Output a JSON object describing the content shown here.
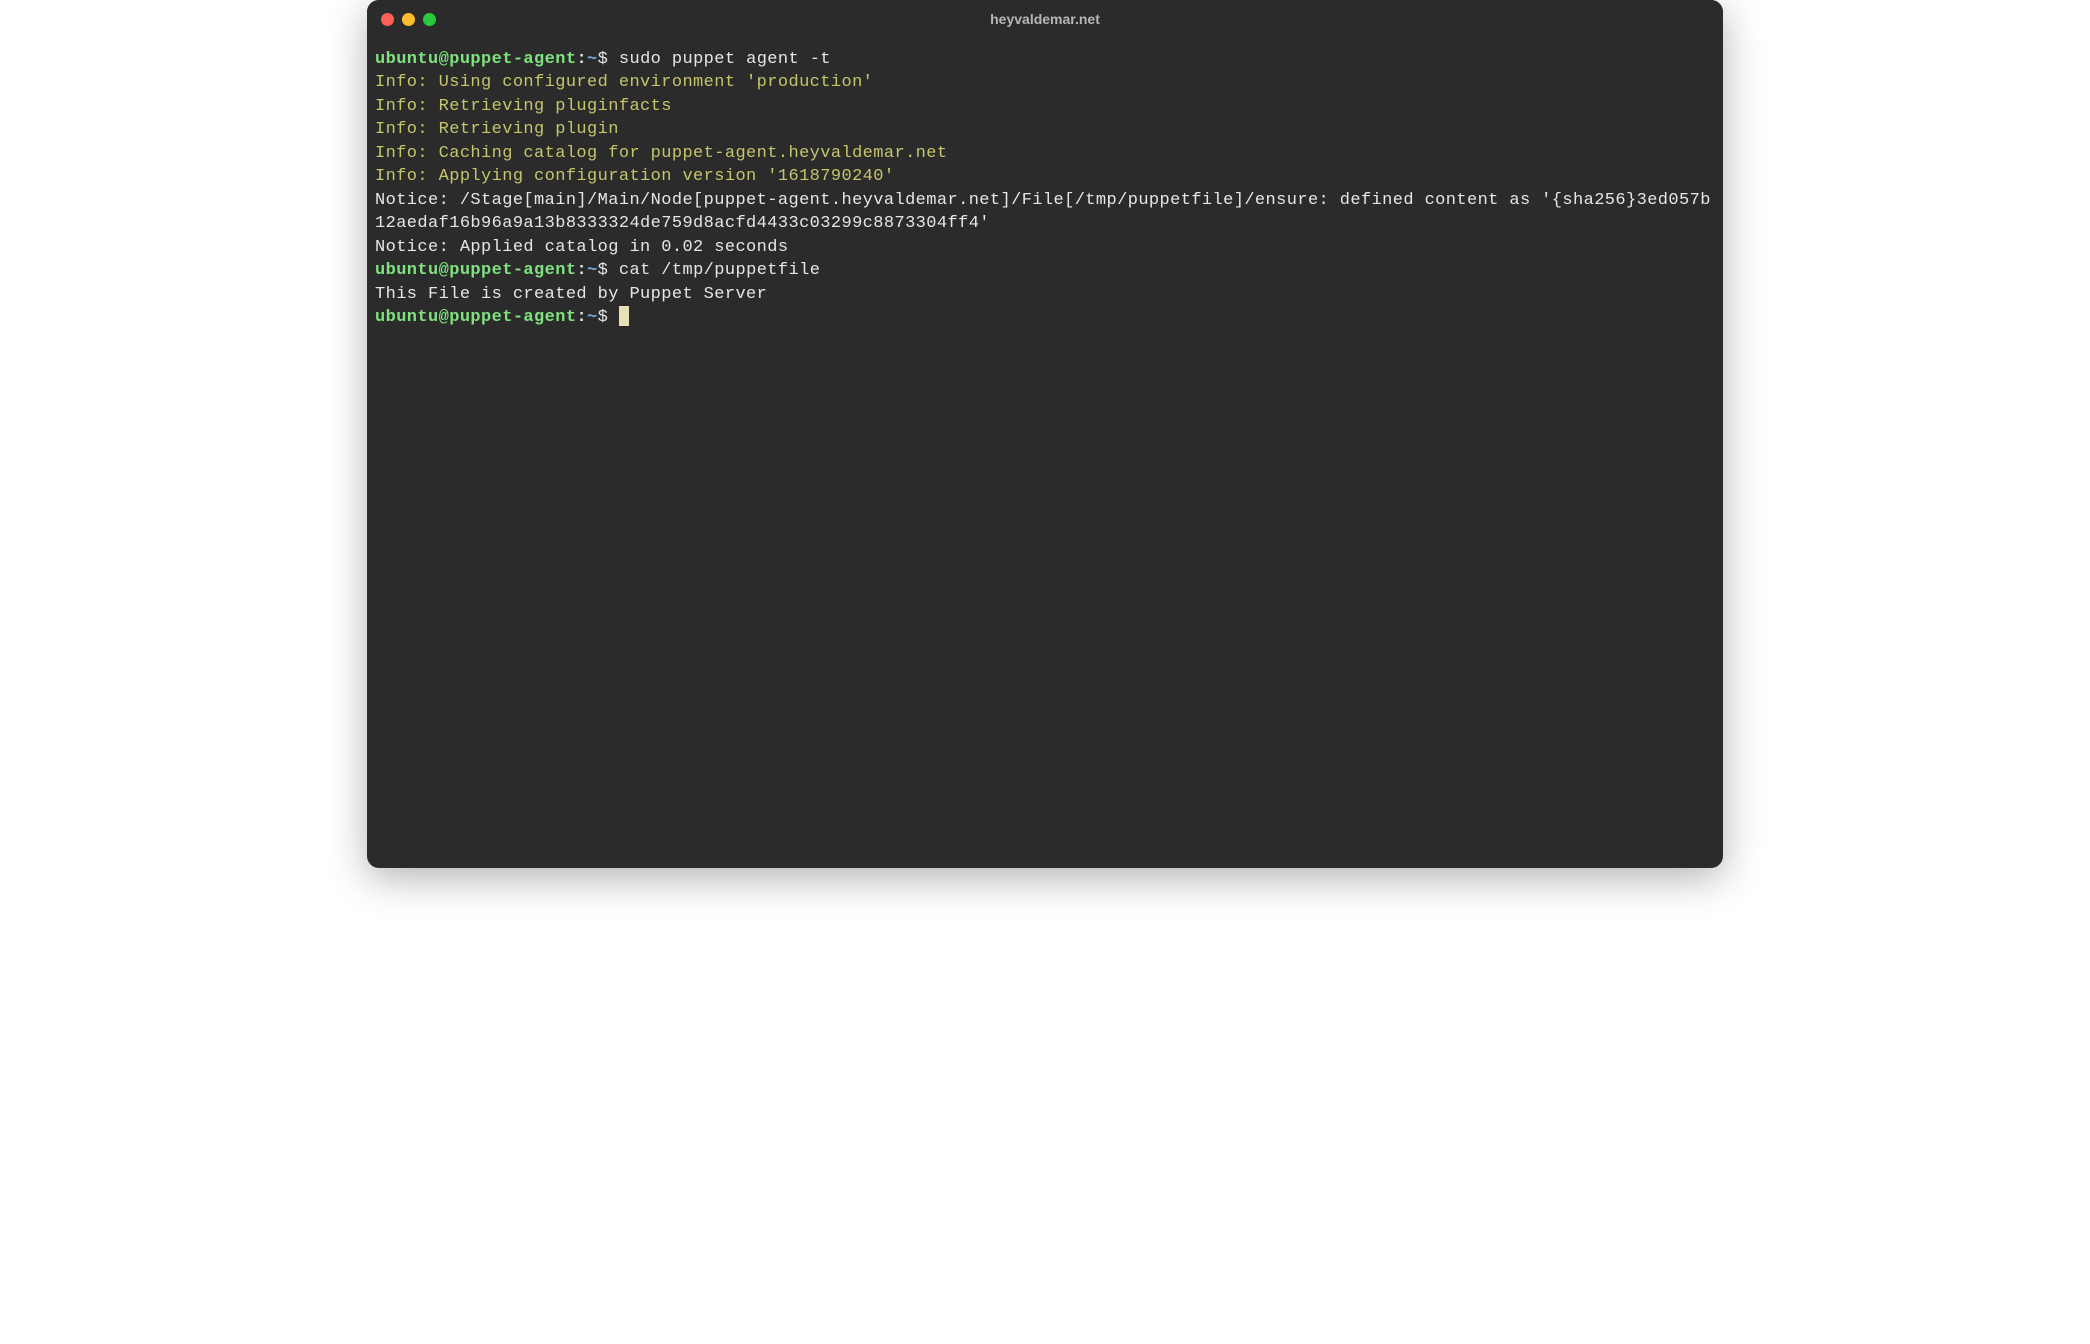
{
  "window": {
    "title": "heyvaldemar.net"
  },
  "colors": {
    "bg": "#2b2b2b",
    "red": "#ff5f56",
    "yellow": "#ffbd2e",
    "green": "#27c93f",
    "prompt_user": "#7fe27f",
    "prompt_path": "#7aa6da",
    "info": "#c5c56a",
    "default": "#e6e6e6",
    "cursor": "#e8e0b8"
  },
  "prompt": {
    "user_host": "ubuntu@puppet-agent",
    "colon": ":",
    "path": "~",
    "dollar": "$"
  },
  "lines": {
    "cmd1": " sudo puppet agent -t",
    "info1": "Info: Using configured environment 'production'",
    "info2": "Info: Retrieving pluginfacts",
    "info3": "Info: Retrieving plugin",
    "info4": "Info: Caching catalog for puppet-agent.heyvaldemar.net",
    "info5": "Info: Applying configuration version '1618790240'",
    "notice1": "Notice: /Stage[main]/Main/Node[puppet-agent.heyvaldemar.net]/File[/tmp/puppetfile]/ensure: defined content as '{sha256}3ed057b12aedaf16b96a9a13b8333324de759d8acfd4433c03299c8873304ff4'",
    "notice2": "Notice: Applied catalog in 0.02 seconds",
    "cmd2": " cat /tmp/puppetfile",
    "output1": "This File is created by Puppet Server",
    "cmd3": " "
  }
}
